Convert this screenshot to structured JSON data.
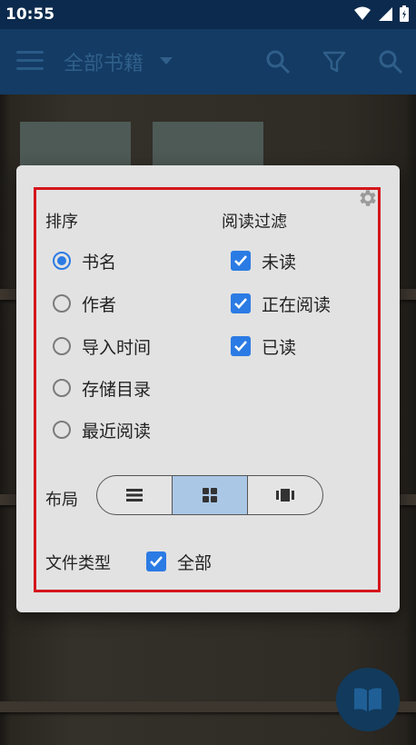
{
  "status_bar": {
    "time": "10:55"
  },
  "app_bar": {
    "title": "全部书籍"
  },
  "dialog": {
    "sort": {
      "title": "排序",
      "options": [
        "书名",
        "作者",
        "导入时间",
        "存储目录",
        "最近阅读"
      ],
      "selected": "书名"
    },
    "filter": {
      "title": "阅读过滤",
      "options": [
        "未读",
        "正在阅读",
        "已读"
      ],
      "checked": [
        true,
        true,
        true
      ]
    },
    "layout": {
      "label": "布局",
      "options": [
        "list-icon",
        "grid-icon",
        "cover-icon"
      ],
      "selected": "grid-icon"
    },
    "file_type": {
      "label": "文件类型",
      "option": "全部",
      "checked": true
    }
  },
  "colors": {
    "accent": "#2b7be4",
    "highlight_border": "#d4161c",
    "selected_segment": "#aac7e6"
  }
}
